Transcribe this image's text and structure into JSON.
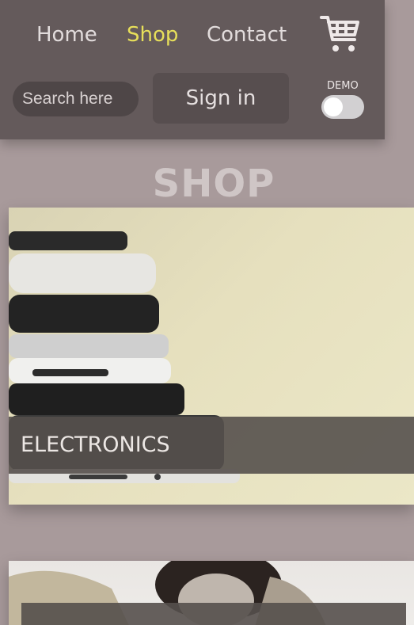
{
  "nav": {
    "items": [
      {
        "label": "Home",
        "active": false
      },
      {
        "label": "Shop",
        "active": true
      },
      {
        "label": "Contact",
        "active": false
      }
    ],
    "cart_icon": "shopping-cart-icon"
  },
  "search": {
    "placeholder": "Search here"
  },
  "auth": {
    "signin_label": "Sign in"
  },
  "demo_toggle": {
    "label": "DEMO",
    "on": false
  },
  "page": {
    "title": "SHOP"
  },
  "categories": [
    {
      "label": "ELECTRONICS"
    },
    {
      "label": ""
    }
  ],
  "colors": {
    "background": "#a89a9b",
    "header": "#645a5b",
    "active_nav": "#e7df5a"
  }
}
